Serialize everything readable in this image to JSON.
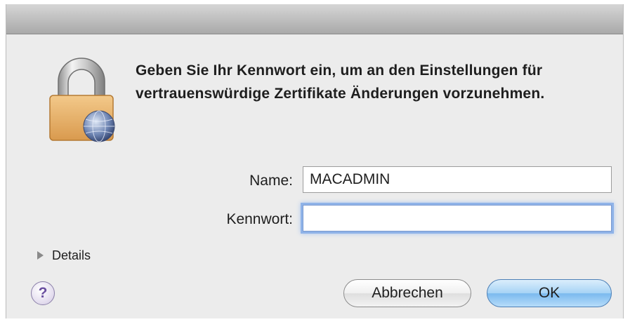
{
  "dialog": {
    "message": "Geben Sie Ihr Kennwort ein, um an den Einstellungen für vertrauenswürdige Zertifikate Änderungen vorzunehmen.",
    "icon": "lock-icon"
  },
  "form": {
    "name_label": "Name:",
    "name_value": "MACADMIN",
    "password_label": "Kennwort:",
    "password_value": ""
  },
  "details": {
    "label": "Details"
  },
  "help": {
    "label": "?"
  },
  "buttons": {
    "cancel": "Abbrechen",
    "ok": "OK"
  },
  "colors": {
    "accent": "#8fb3e8",
    "default_button": "#7ab9ee"
  }
}
